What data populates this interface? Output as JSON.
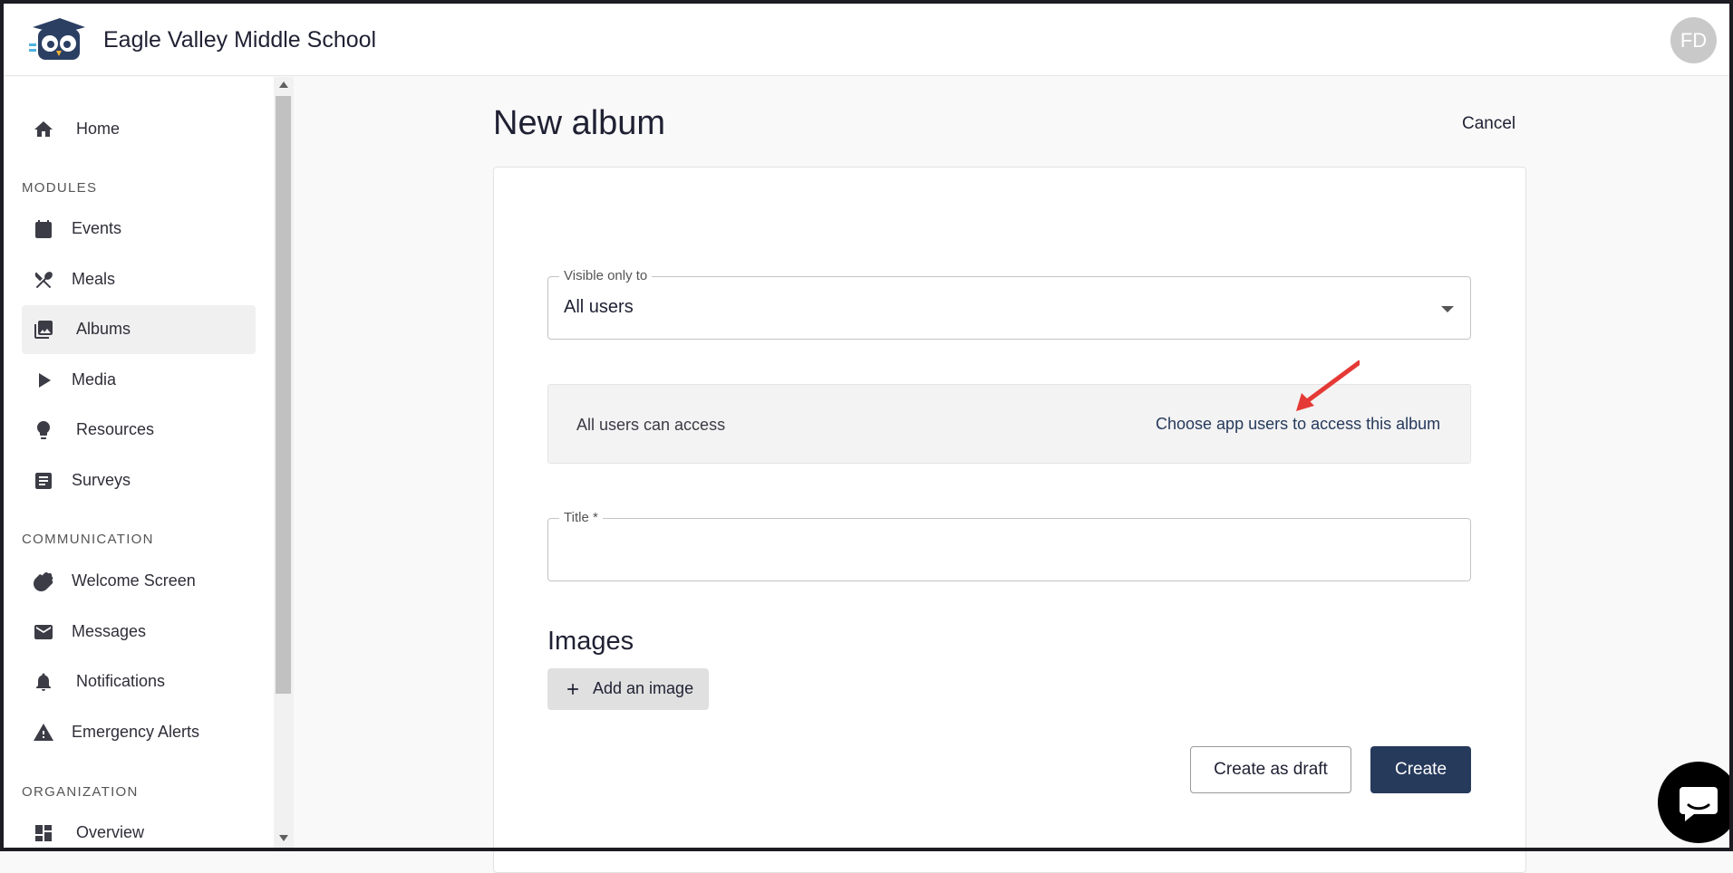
{
  "header": {
    "school_name": "Eagle Valley Middle School",
    "avatar_initials": "FD"
  },
  "sidebar": {
    "home": {
      "label": "Home",
      "icon": "home-icon"
    },
    "sections": {
      "modules": "MODULES",
      "communication": "COMMUNICATION",
      "organization": "ORGANIZATION"
    },
    "modules": [
      {
        "label": "Events",
        "icon": "calendar-icon"
      },
      {
        "label": "Meals",
        "icon": "utensils-icon"
      },
      {
        "label": "Albums",
        "icon": "photo-library-icon",
        "active": true
      },
      {
        "label": "Media",
        "icon": "play-icon"
      },
      {
        "label": "Resources",
        "icon": "lightbulb-icon"
      },
      {
        "label": "Surveys",
        "icon": "survey-icon"
      }
    ],
    "communication": [
      {
        "label": "Welcome Screen",
        "icon": "waving-hand-icon"
      },
      {
        "label": "Messages",
        "icon": "mail-icon"
      },
      {
        "label": "Notifications",
        "icon": "bell-icon"
      },
      {
        "label": "Emergency Alerts",
        "icon": "warning-icon"
      }
    ],
    "organization": [
      {
        "label": "Overview",
        "icon": "dashboard-icon"
      }
    ]
  },
  "main": {
    "page_title": "New album",
    "cancel_label": "Cancel",
    "visibility": {
      "legend": "Visible only to",
      "value": "All users"
    },
    "access": {
      "text": "All users can access",
      "link": "Choose app users to access this album"
    },
    "title_field": {
      "legend": "Title *",
      "value": ""
    },
    "images": {
      "heading": "Images",
      "add_label": "Add an image"
    },
    "actions": {
      "draft_label": "Create as draft",
      "create_label": "Create"
    }
  },
  "colors": {
    "primary": "#263a5c",
    "annotation_arrow": "#e53935",
    "active_nav_bg": "#f0f0f0"
  }
}
